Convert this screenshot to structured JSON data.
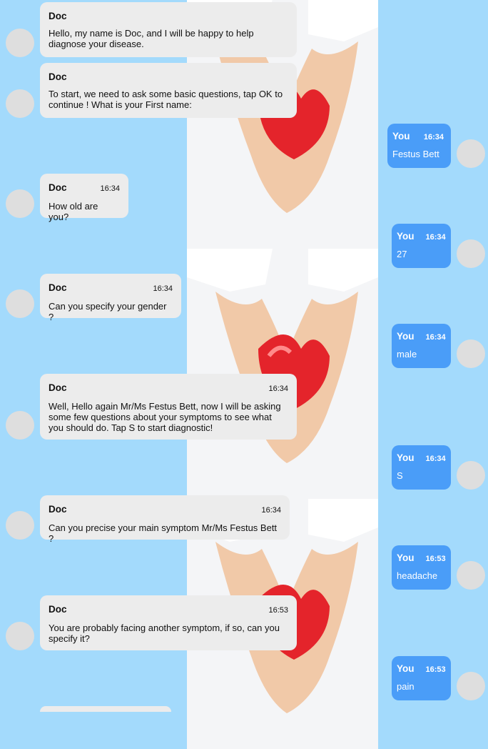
{
  "theme": {
    "background": "#a3dafc",
    "doc_bubble": "#ececec",
    "you_bubble": "#4a9df8"
  },
  "messages": [
    {
      "sender": "Doc",
      "time": "",
      "text": "Hello, my name is Doc, and I will be happy to help diagnose your disease."
    },
    {
      "sender": "Doc",
      "time": "",
      "text": "To start, we need to ask some basic questions, tap OK to continue ! What is your First name:"
    },
    {
      "sender": "You",
      "time": "16:34",
      "text": "Festus Bett"
    },
    {
      "sender": "Doc",
      "time": "16:34",
      "text": "How old are you?"
    },
    {
      "sender": "You",
      "time": "16:34",
      "text": "27"
    },
    {
      "sender": "Doc",
      "time": "16:34",
      "text": "Can you specify your gender ?"
    },
    {
      "sender": "You",
      "time": "16:34",
      "text": "male"
    },
    {
      "sender": "Doc",
      "time": "16:34",
      "text": "Well, Hello again Mr/Ms Festus Bett, now I will be asking some few questions about your symptoms to see what you should do. Tap S to start diagnostic!"
    },
    {
      "sender": "You",
      "time": "16:34",
      "text": "S"
    },
    {
      "sender": "Doc",
      "time": "16:34",
      "text": "Can you precise your main symptom Mr/Ms Festus Bett ?"
    },
    {
      "sender": "You",
      "time": "16:53",
      "text": "headache"
    },
    {
      "sender": "Doc",
      "time": "16:53",
      "text": "You are probably facing another symptom, if so, can you specify it?"
    },
    {
      "sender": "You",
      "time": "16:53",
      "text": "pain"
    }
  ]
}
